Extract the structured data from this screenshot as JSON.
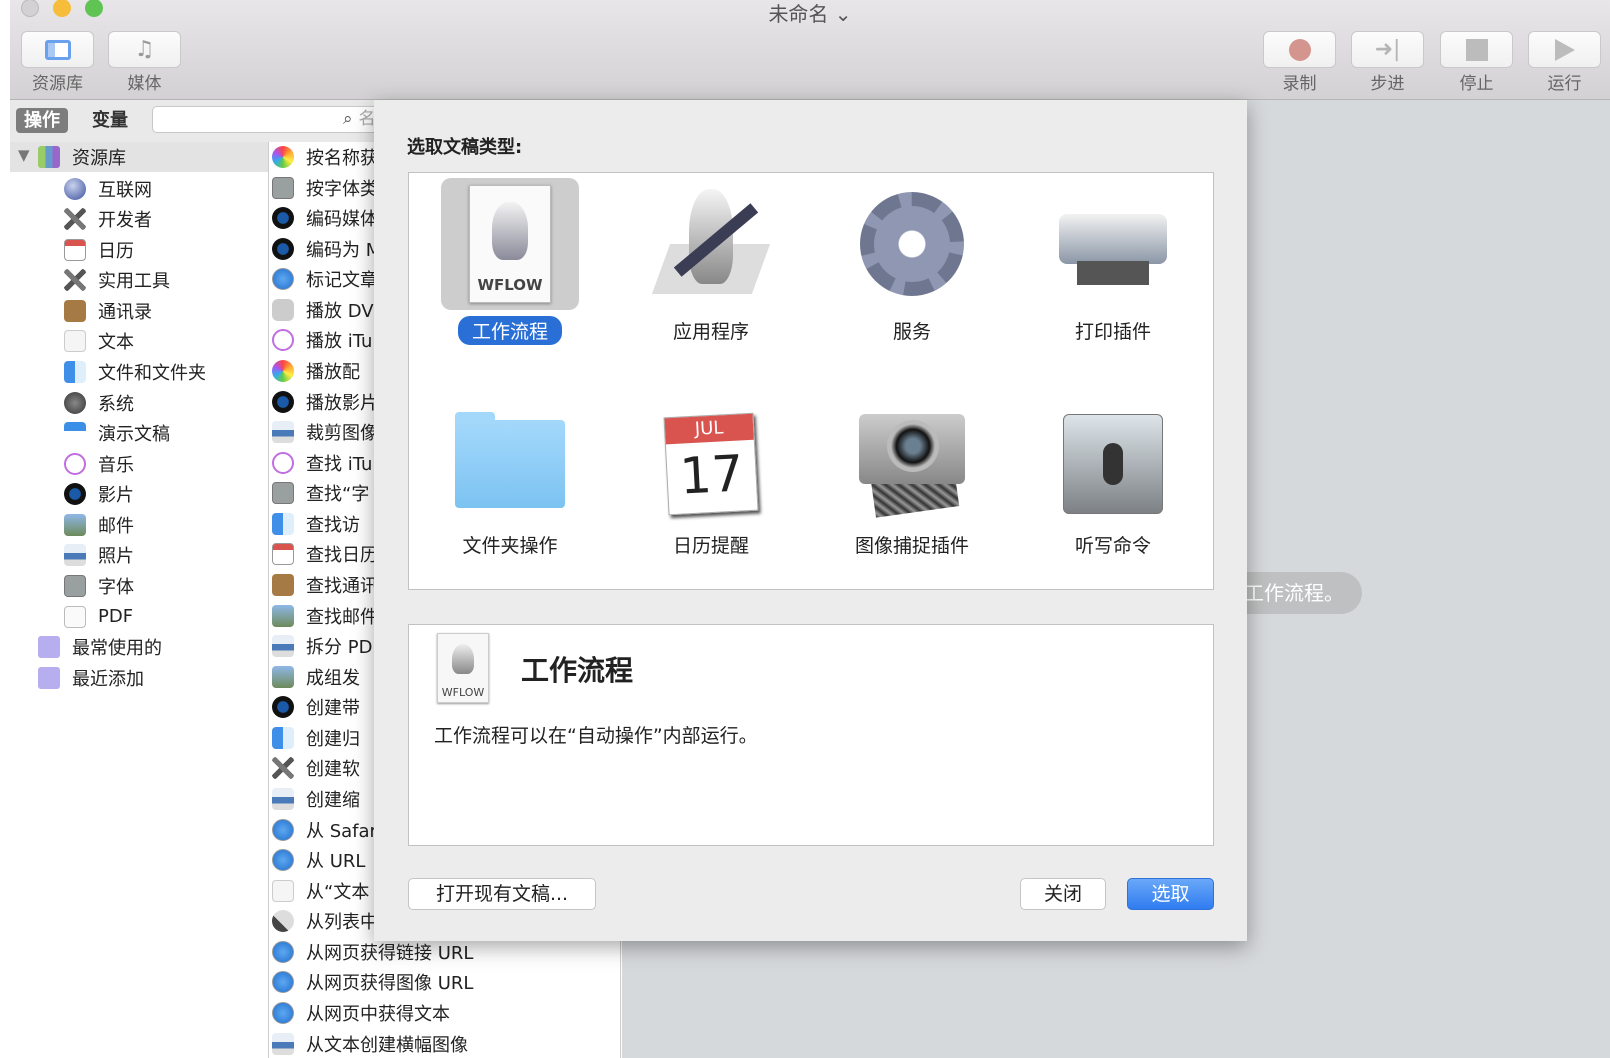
{
  "window": {
    "title": "未命名 ⌄"
  },
  "toolbar": {
    "left": [
      {
        "label": "资源库",
        "icon": "sidebar-icon"
      },
      {
        "label": "媒体",
        "icon": "media-icon"
      }
    ],
    "right": [
      {
        "label": "录制",
        "icon": "record-icon"
      },
      {
        "label": "步进",
        "icon": "step-icon"
      },
      {
        "label": "停止",
        "icon": "stop-icon"
      },
      {
        "label": "运行",
        "icon": "run-icon"
      }
    ]
  },
  "tabs": {
    "actions": "操作",
    "variables": "变量",
    "search_placeholder": "名"
  },
  "library": {
    "root": "资源库",
    "items": [
      {
        "label": "互联网",
        "icon": "globe"
      },
      {
        "label": "开发者",
        "icon": "tools"
      },
      {
        "label": "日历",
        "icon": "calendar"
      },
      {
        "label": "实用工具",
        "icon": "tools"
      },
      {
        "label": "通讯录",
        "icon": "contacts"
      },
      {
        "label": "文本",
        "icon": "text"
      },
      {
        "label": "文件和文件夹",
        "icon": "finder"
      },
      {
        "label": "系统",
        "icon": "system"
      },
      {
        "label": "演示文稿",
        "icon": "keynote"
      },
      {
        "label": "音乐",
        "icon": "itunes"
      },
      {
        "label": "影片",
        "icon": "quicktime"
      },
      {
        "label": "邮件",
        "icon": "mail"
      },
      {
        "label": "照片",
        "icon": "preview"
      },
      {
        "label": "字体",
        "icon": "font"
      },
      {
        "label": "PDF",
        "icon": "pdf"
      }
    ],
    "folders": [
      "最常使用的",
      "最近添加"
    ]
  },
  "actions": [
    {
      "label": "按名称获",
      "icon": "photos"
    },
    {
      "label": "按字体类",
      "icon": "font"
    },
    {
      "label": "编码媒体",
      "icon": "quicktime"
    },
    {
      "label": "编码为 M",
      "icon": "quicktime"
    },
    {
      "label": "标记文章",
      "icon": "safari"
    },
    {
      "label": "播放 DV",
      "icon": "dvd"
    },
    {
      "label": "播放 iTu",
      "icon": "itunes"
    },
    {
      "label": "播放配",
      "icon": "photos"
    },
    {
      "label": "播放影片",
      "icon": "quicktime"
    },
    {
      "label": "裁剪图像",
      "icon": "preview"
    },
    {
      "label": "查找 iTu",
      "icon": "itunes"
    },
    {
      "label": "查找“字",
      "icon": "font"
    },
    {
      "label": "查找访",
      "icon": "finder"
    },
    {
      "label": "查找日历",
      "icon": "calendar"
    },
    {
      "label": "查找通讯",
      "icon": "contacts"
    },
    {
      "label": "查找邮件",
      "icon": "mail"
    },
    {
      "label": "拆分 PD",
      "icon": "preview"
    },
    {
      "label": "成组发",
      "icon": "mail"
    },
    {
      "label": "创建带",
      "icon": "quicktime"
    },
    {
      "label": "创建归",
      "icon": "finder"
    },
    {
      "label": "创建软",
      "icon": "tools"
    },
    {
      "label": "创建缩",
      "icon": "preview"
    },
    {
      "label": "从 Safari",
      "icon": "safari"
    },
    {
      "label": "从 URL",
      "icon": "safari"
    },
    {
      "label": "从“文本",
      "icon": "text"
    },
    {
      "label": "从列表中",
      "icon": "automator"
    },
    {
      "label": "从网页获得链接 URL",
      "icon": "safari"
    },
    {
      "label": "从网页获得图像 URL",
      "icon": "safari"
    },
    {
      "label": "从网页中获得文本",
      "icon": "safari"
    },
    {
      "label": "从文本创建横幅图像",
      "icon": "preview"
    }
  ],
  "tooltip": "工作流程。",
  "dialog": {
    "title": "选取文稿类型:",
    "types": [
      {
        "label": "工作流程",
        "icon": "workflow-doc-icon",
        "selected": true,
        "badge": "WFLOW"
      },
      {
        "label": "应用程序",
        "icon": "automator-app-icon"
      },
      {
        "label": "服务",
        "icon": "gear-icon"
      },
      {
        "label": "打印插件",
        "icon": "printer-icon"
      },
      {
        "label": "文件夹操作",
        "icon": "folder-icon"
      },
      {
        "label": "日历提醒",
        "icon": "calendar-icon",
        "month": "JUL",
        "day": "17"
      },
      {
        "label": "图像捕捉插件",
        "icon": "camera-icon"
      },
      {
        "label": "听写命令",
        "icon": "microphone-icon"
      }
    ],
    "description": {
      "title": "工作流程",
      "badge": "WFLOW",
      "text": "工作流程可以在“自动操作”内部运行。"
    },
    "buttons": {
      "open": "打开现有文稿...",
      "close": "关闭",
      "choose": "选取"
    }
  },
  "colors": {
    "accent": "#3478f6",
    "selection": "#2a6fd6",
    "record": "#d4958f"
  }
}
